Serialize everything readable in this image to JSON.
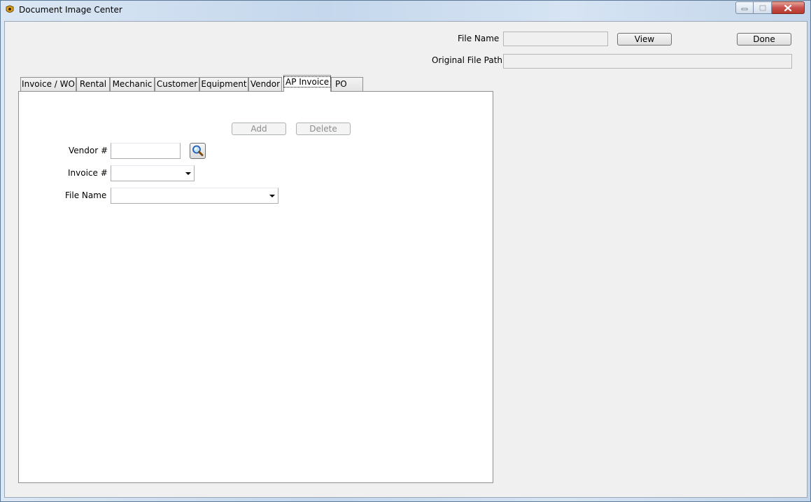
{
  "window": {
    "title": "Document Image Center",
    "controls": {
      "minimize": "minimize",
      "maximize": "maximize",
      "close": "close"
    }
  },
  "header": {
    "file_name_label": "File Name",
    "file_name_value": "",
    "view_button": "View",
    "done_button": "Done",
    "original_path_label": "Original File Path",
    "original_path_value": ""
  },
  "tabs": [
    {
      "label": "Invoice / WO"
    },
    {
      "label": "Rental"
    },
    {
      "label": "Mechanic"
    },
    {
      "label": "Customer"
    },
    {
      "label": "Equipment"
    },
    {
      "label": "Vendor"
    },
    {
      "label": "AP Invoice",
      "active": true
    },
    {
      "label": "PO"
    }
  ],
  "ap_invoice": {
    "add_button": "Add",
    "delete_button": "Delete",
    "vendor_label": "Vendor #",
    "vendor_value": "",
    "invoice_label": "Invoice #",
    "invoice_value": "",
    "file_name_label": "File Name",
    "file_name_value": ""
  },
  "icons": {
    "app": "app-icon",
    "search": "search-icon",
    "dropdown": "chevron-down-icon"
  },
  "colors": {
    "title_bar": "#c9d9ea",
    "client_bg": "#f0f0f0",
    "close_button": "#c75050"
  }
}
